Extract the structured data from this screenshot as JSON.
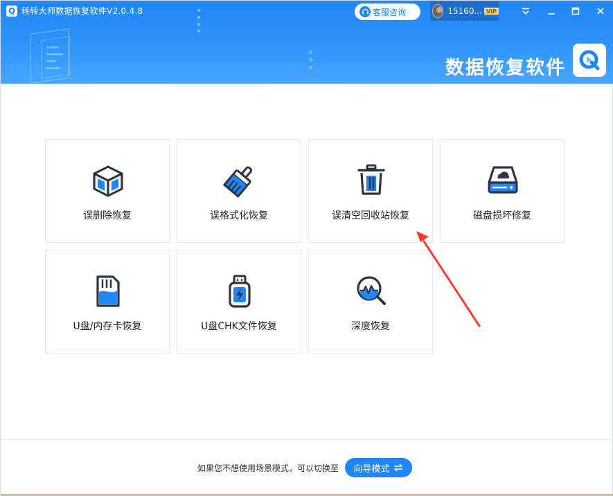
{
  "window": {
    "title": "转转大师数据恢复软件V2.0.4.8",
    "logo_glyph": "Q",
    "minimize_icon": "minimize-icon",
    "maximize_icon": "maximize-icon",
    "close_icon": "close-icon",
    "menu_icon": "menu-icon"
  },
  "header": {
    "customer_service_label": "客服咨询",
    "user_name": "15160...",
    "vip_label": "VIP",
    "brand_text": "数据恢复软件"
  },
  "modes": [
    {
      "label": "误删除恢复",
      "icon": "box-icon"
    },
    {
      "label": "误格式化恢复",
      "icon": "broom-icon"
    },
    {
      "label": "误清空回收站恢复",
      "icon": "trash-icon"
    },
    {
      "label": "磁盘损坏修复",
      "icon": "disk-icon"
    },
    {
      "label": "U盘/内存卡恢复",
      "icon": "sd-card-icon"
    },
    {
      "label": "U盘CHK文件恢复",
      "icon": "usb-drive-icon"
    },
    {
      "label": "深度恢复",
      "icon": "magnifier-icon"
    }
  ],
  "footer": {
    "hint": "如果您不想使用场景模式，可以切换至",
    "guide_button_label": "向导模式"
  },
  "colors": {
    "primary": "#1f86f6",
    "icon_dark": "#2f3540",
    "arrow": "#ff3b30"
  }
}
